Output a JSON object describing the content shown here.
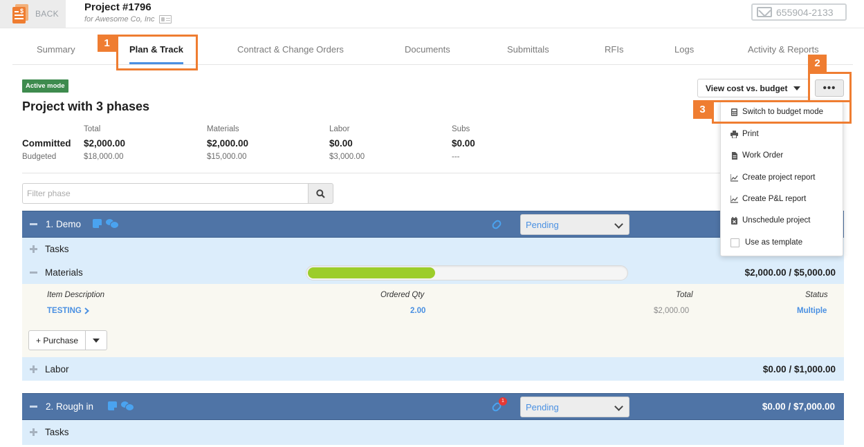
{
  "topbar": {
    "back_label": "BACK",
    "project_title": "Project #1796",
    "project_client": "for Awesome Co, Inc",
    "phone": "655904-2133"
  },
  "tabs": [
    {
      "label": "Summary",
      "active": false
    },
    {
      "label": "Plan & Track",
      "active": true
    },
    {
      "label": "Contract & Change Orders",
      "active": false
    },
    {
      "label": "Documents",
      "active": false
    },
    {
      "label": "Submittals",
      "active": false
    },
    {
      "label": "RFIs",
      "active": false
    },
    {
      "label": "Logs",
      "active": false
    },
    {
      "label": "Activity & Reports",
      "active": false
    }
  ],
  "callouts": [
    "1",
    "2",
    "3"
  ],
  "header": {
    "mode_badge": "Active mode",
    "title": "Project with 3 phases",
    "view_button": "View cost vs. budget",
    "more_button": "•••"
  },
  "summary": {
    "row_committed": "Committed",
    "row_budgeted": "Budgeted",
    "columns": [
      {
        "label": "Total",
        "committed": "$2,000.00",
        "budgeted": "$18,000.00"
      },
      {
        "label": "Materials",
        "committed": "$2,000.00",
        "budgeted": "$15,000.00"
      },
      {
        "label": "Labor",
        "committed": "$0.00",
        "budgeted": "$3,000.00"
      },
      {
        "label": "Subs",
        "committed": "$0.00",
        "budgeted": "---"
      }
    ]
  },
  "filter": {
    "placeholder": "Filter phase",
    "value": ""
  },
  "menu": {
    "items": [
      {
        "label": "Switch to budget mode",
        "icon": "calculator-icon"
      },
      {
        "label": "Print",
        "icon": "printer-icon"
      },
      {
        "label": "Work Order",
        "icon": "document-icon"
      },
      {
        "label": "Create project report",
        "icon": "chart-icon"
      },
      {
        "label": "Create P&L report",
        "icon": "chart-icon"
      },
      {
        "label": "Unschedule project",
        "icon": "calendar-x-icon"
      },
      {
        "label": "Use as template",
        "icon": "checkbox-icon"
      }
    ]
  },
  "phases": [
    {
      "name": "1. Demo",
      "status": "Pending",
      "amount": "",
      "sections": {
        "tasks": "Tasks",
        "materials": "Materials",
        "materials_amount": "$2,000.00 / $5,000.00",
        "materials_progress": 0.4,
        "labor": "Labor",
        "labor_amount": "$0.00 / $1,000.00"
      },
      "materials_table": {
        "headers": [
          "Item Description",
          "Ordered Qty",
          "Total",
          "Status"
        ],
        "rows": [
          {
            "item": "TESTING",
            "qty": "2.00",
            "total": "$2,000.00",
            "status": "Multiple"
          }
        ],
        "purchase_button": "+ Purchase"
      }
    },
    {
      "name": "2. Rough in",
      "status": "Pending",
      "amount": "$0.00 / $7,000.00",
      "notification_count": "1",
      "sections": {
        "tasks": "Tasks"
      }
    }
  ],
  "colors": {
    "accent": "#ef7d31",
    "phase_bar": "#4f74a6",
    "section_bg": "#dcedfb",
    "link_blue": "#4a90e2",
    "progress": "#9ccd2a",
    "badge": "#3e8b4e"
  }
}
